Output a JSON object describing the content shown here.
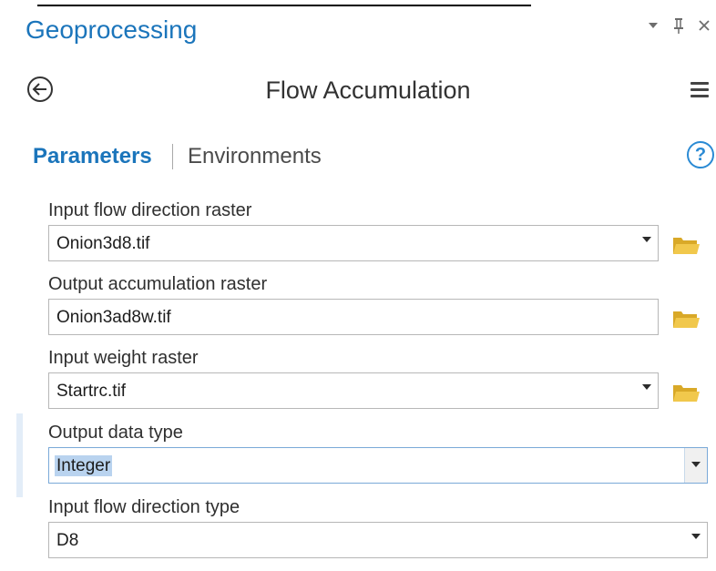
{
  "pane": {
    "title": "Geoprocessing",
    "controls": {
      "auto_hide": "▾",
      "pin": "⊥",
      "close": "✕"
    }
  },
  "tool": {
    "title": "Flow Accumulation",
    "back_icon": "back-arrow-icon",
    "menu_icon": "hamburger-menu-icon"
  },
  "tabs": {
    "parameters": "Parameters",
    "environments": "Environments",
    "help": "?"
  },
  "parameters": [
    {
      "label": "Input flow direction raster",
      "value": "Onion3d8.tif",
      "control": "dropdown",
      "browse": true
    },
    {
      "label": "Output accumulation raster",
      "value": "Onion3ad8w.tif",
      "control": "text",
      "browse": true
    },
    {
      "label": "Input weight raster",
      "value": "Startrc.tif",
      "control": "dropdown",
      "browse": true
    },
    {
      "label": "Output data type",
      "value": "Integer",
      "control": "dropdown",
      "browse": false,
      "selected": true
    },
    {
      "label": "Input flow direction type",
      "value": "D8",
      "control": "dropdown",
      "browse": false
    }
  ],
  "colors": {
    "accent": "#1b75bb",
    "folder": "#e0b537",
    "selection": "#b9d3ef"
  }
}
